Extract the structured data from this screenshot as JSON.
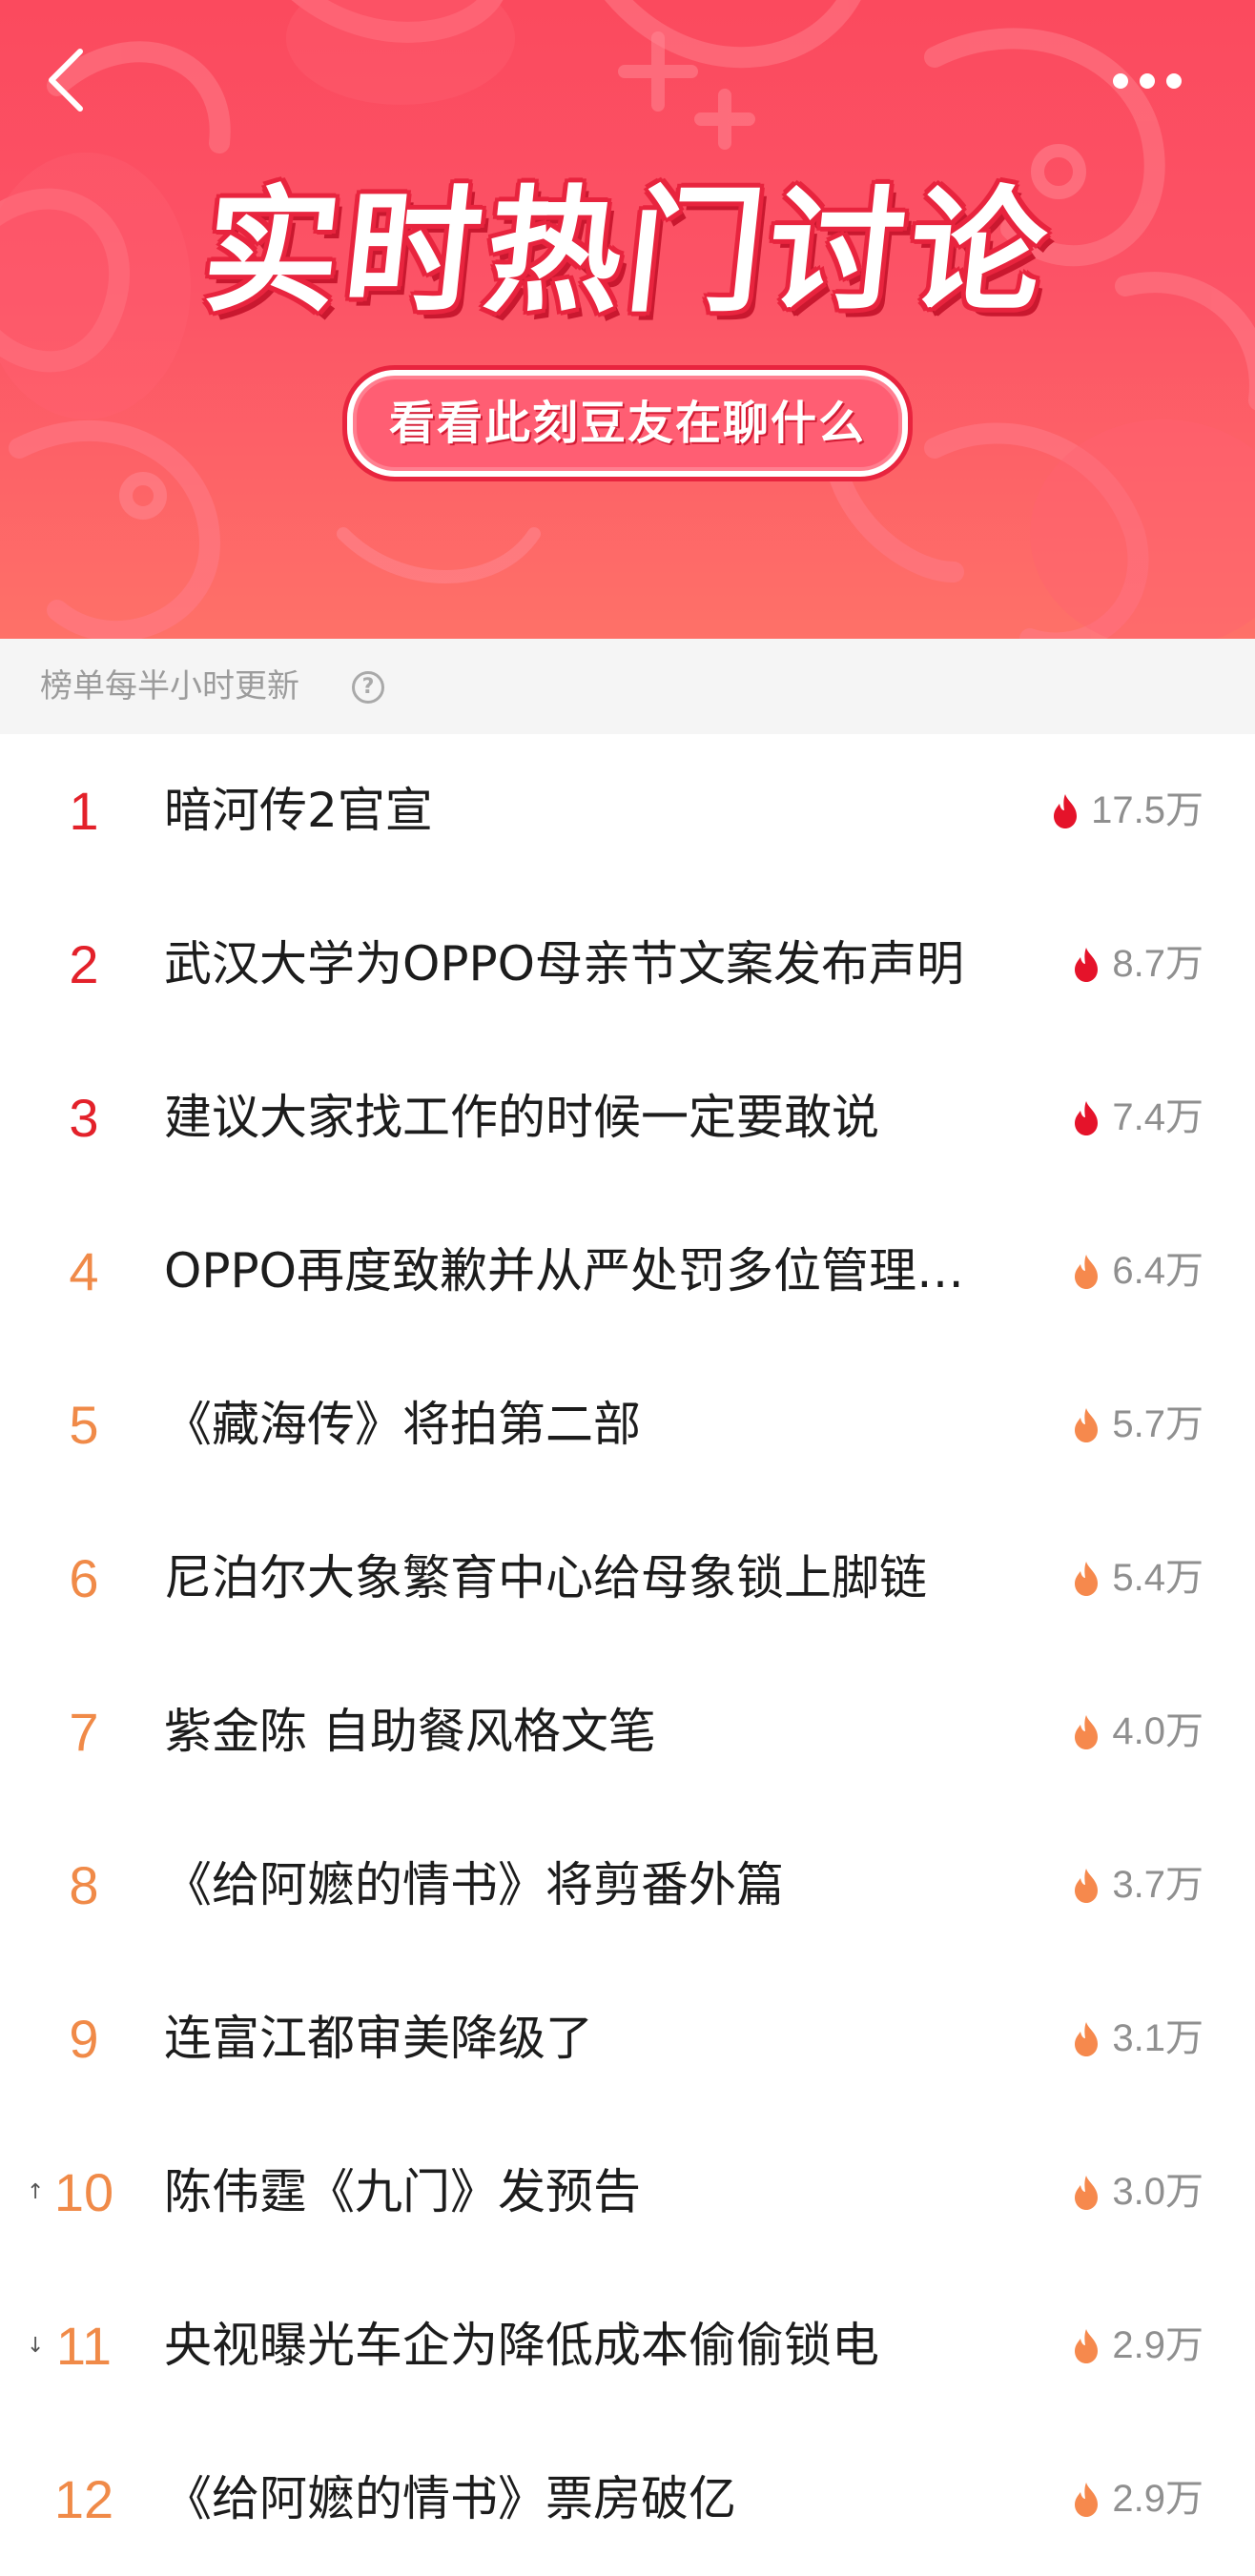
{
  "header": {
    "title": "实时热门讨论",
    "subtitle": "看看此刻豆友在聊什么",
    "back_icon": "chevron-left-icon",
    "more_icon": "more-horizontal-icon"
  },
  "notice": {
    "text": "榜单每半小时更新",
    "help_icon": "question-circle-icon"
  },
  "colors": {
    "banner": "#fb4a5e",
    "top_rank": "#e3212a",
    "other_rank": "#f08a48",
    "hot_flame": "#e5132a",
    "warm_flame": "#f6894d"
  },
  "list": {
    "items": [
      {
        "rank": "1",
        "title": "暗河传2官宣",
        "heat": "17.5万",
        "trend": "",
        "top": true
      },
      {
        "rank": "2",
        "title": "武汉大学为OPPO母亲节文案发布声明",
        "heat": "8.7万",
        "trend": "",
        "top": true
      },
      {
        "rank": "3",
        "title": "建议大家找工作的时候一定要敢说",
        "heat": "7.4万",
        "trend": "",
        "top": true
      },
      {
        "rank": "4",
        "title": "OPPO再度致歉并从严处罚多位管理人员",
        "heat": "6.4万",
        "trend": "",
        "top": false
      },
      {
        "rank": "5",
        "title": "《藏海传》将拍第二部",
        "heat": "5.7万",
        "trend": "",
        "top": false
      },
      {
        "rank": "6",
        "title": "尼泊尔大象繁育中心给母象锁上脚链",
        "heat": "5.4万",
        "trend": "",
        "top": false
      },
      {
        "rank": "7",
        "title": "紫金陈 自助餐风格文笔",
        "heat": "4.0万",
        "trend": "",
        "top": false
      },
      {
        "rank": "8",
        "title": "《给阿嬷的情书》将剪番外篇",
        "heat": "3.7万",
        "trend": "",
        "top": false
      },
      {
        "rank": "9",
        "title": "连富江都审美降级了",
        "heat": "3.1万",
        "trend": "",
        "top": false
      },
      {
        "rank": "10",
        "title": "陈伟霆《九门》发预告",
        "heat": "3.0万",
        "trend": "↑",
        "top": false
      },
      {
        "rank": "11",
        "title": "央视曝光车企为降低成本偷偷锁电",
        "heat": "2.9万",
        "trend": "↓",
        "top": false
      },
      {
        "rank": "12",
        "title": "《给阿嬷的情书》票房破亿",
        "heat": "2.9万",
        "trend": "",
        "top": false
      }
    ]
  }
}
